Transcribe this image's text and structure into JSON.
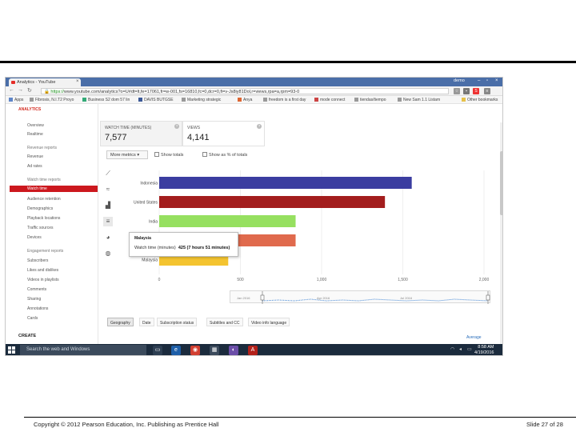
{
  "slide": {
    "footer_left": "Copyright © 2012 Pearson Education, Inc. Publishing as Prentice Hall",
    "footer_right": "Slide 27 of 28"
  },
  "browser": {
    "tab_title": "Analytics - YouTube",
    "user": "demo",
    "url_prefix": "https://",
    "url": "www.youtube.com/analytics?o=U#dt=lt,fe=17061,fr=w-001,fs=16810,fc=0,dcr=0,fi=v-Js8iy81Dol,r=views,rpa=a,rpm=93-0",
    "bookmarks": [
      "Apps",
      "Fibrosis, N.I.T2 Proyo",
      "Business S2 dom 57 lin",
      "DAVIS BUTGSE",
      "Marketing strategic",
      "Anya",
      "freedom is a first day",
      "mode connect",
      "tiendas/tiempo",
      "New Sam 1.1 Listam",
      "Other bookmarks"
    ]
  },
  "sidebar": {
    "section_title": "ANALYTICS",
    "items_top": [
      "Overview",
      "Realtime"
    ],
    "revenue_group": [
      "Revenue reports",
      "Revenue",
      "Ad rates"
    ],
    "watch_group_title": "Watch time reports",
    "active_item": "Watch time",
    "watch_group": [
      "Audience retention",
      "Demographics",
      "Playback locations",
      "Traffic sources",
      "Devices"
    ],
    "engagement_title": "Engagement reports",
    "engagement_group": [
      "Subscribers",
      "Likes and dislikes",
      "Videos in playlists",
      "Comments",
      "Sharing",
      "Annotations",
      "Cards"
    ],
    "create_label": "CREATE"
  },
  "metrics": [
    {
      "label": "WATCH TIME (MINUTES)",
      "value": "7,577"
    },
    {
      "label": "VIEWS",
      "value": "4,141"
    }
  ],
  "toolbar": {
    "more_metrics": "More metrics",
    "show_totals": "Show totals",
    "show_pct": "Show as % of totals"
  },
  "tooltip": {
    "title": "Malaysia",
    "metric": "Watch time (minutes)",
    "value": "425 (7 hours 51 minutes)"
  },
  "timeline_labels": [
    "Jan 2016",
    "Apr 2016",
    "Jul 2016"
  ],
  "dimension_tabs": [
    "Geography",
    "Date",
    "Subscription status",
    "Subtitles and CC",
    "Video info language"
  ],
  "average_link": "Average",
  "taskbar": {
    "search_placeholder": "Search the web and Windows",
    "time": "8:58 AM",
    "date": "4/19/2016"
  },
  "colors": {
    "youtube_red": "#cc181e",
    "taskbar": "#1b2b3d"
  },
  "chart_data": {
    "type": "bar",
    "orientation": "horizontal",
    "categories": [
      "Indonesia",
      "United States",
      "India",
      "Ireland",
      "Malaysia"
    ],
    "values": [
      1555,
      1390,
      840,
      840,
      425
    ],
    "colors": [
      "#3b3da0",
      "#a31d1d",
      "#96e060",
      "#e06a4d",
      "#f4c430"
    ],
    "x_ticks": [
      "0",
      "500",
      "1,000",
      "1,500",
      "2,000"
    ],
    "xlim": [
      0,
      2000
    ]
  }
}
